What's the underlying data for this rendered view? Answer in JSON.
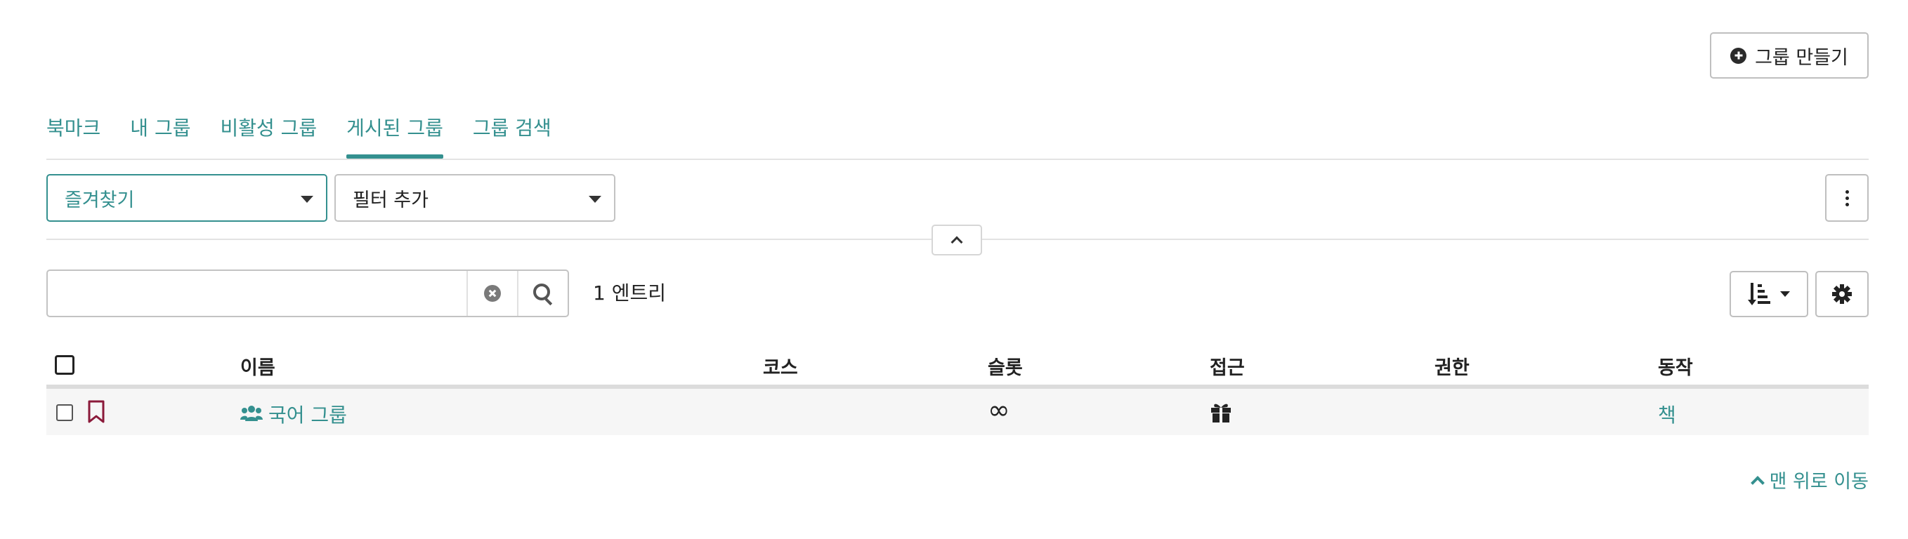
{
  "header": {
    "create_group_label": "그룹 만들기"
  },
  "tabs": [
    {
      "label": "북마크",
      "active": false
    },
    {
      "label": "내 그룹",
      "active": false
    },
    {
      "label": "비활성 그룹",
      "active": false
    },
    {
      "label": "게시된 그룹",
      "active": true
    },
    {
      "label": "그룹 검색",
      "active": false
    }
  ],
  "filters": {
    "favorites_label": "즐겨찾기",
    "add_filter_label": "필터 추가"
  },
  "search": {
    "value": "",
    "placeholder": "",
    "entries_text": "1 엔트리"
  },
  "table": {
    "columns": [
      "이름",
      "코스",
      "슬롯",
      "접근",
      "권한",
      "동작"
    ],
    "rows": [
      {
        "name": "국어 그룹",
        "course": "",
        "slots": "∞",
        "access": "gift-icon",
        "rights": "",
        "action": "책"
      }
    ]
  },
  "footer": {
    "to_top_label": "맨 위로 이동"
  },
  "colors": {
    "accent": "#34908f",
    "bookmark": "#8b1a3a"
  },
  "icons": {
    "create": "plus-circle-icon",
    "collapse": "chevron-up-icon",
    "clear": "clear-icon",
    "search": "search-icon",
    "sort": "sort-icon",
    "settings": "gear-icon",
    "more": "kebab-icon",
    "bookmark": "bookmark-icon",
    "group": "users-icon"
  }
}
